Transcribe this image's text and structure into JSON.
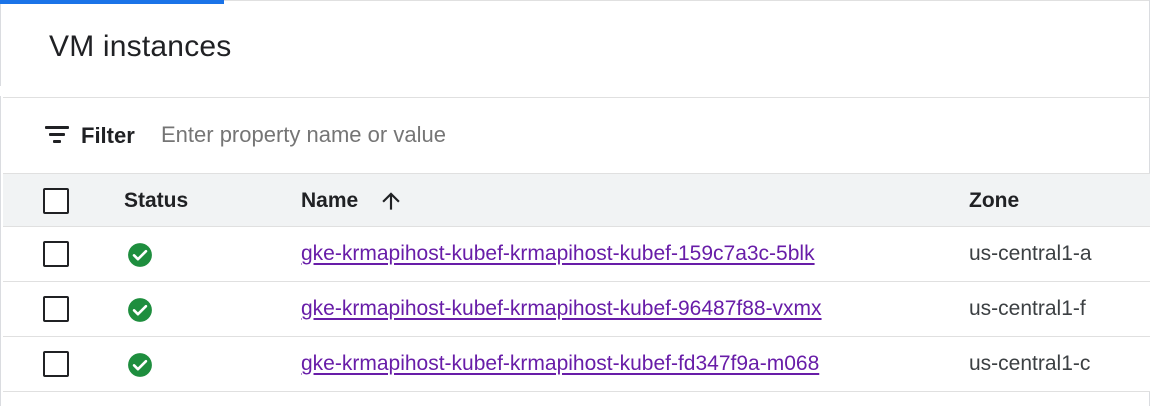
{
  "page": {
    "title": "VM instances"
  },
  "filter": {
    "label": "Filter",
    "placeholder": "Enter property name or value",
    "icon": "filter-list-icon"
  },
  "table": {
    "columns": {
      "select": "",
      "status": "Status",
      "name": "Name",
      "zone": "Zone"
    },
    "sort": {
      "column": "Name",
      "direction": "ascending",
      "icon": "arrow-upward-icon"
    },
    "rows": [
      {
        "selected": false,
        "status": "running",
        "status_icon": "check-circle-icon",
        "name": "gke-krmapihost-kubef-krmapihost-kubef-159c7a3c-5blk",
        "zone": "us-central1-a"
      },
      {
        "selected": false,
        "status": "running",
        "status_icon": "check-circle-icon",
        "name": "gke-krmapihost-kubef-krmapihost-kubef-96487f88-vxmx",
        "zone": "us-central1-f"
      },
      {
        "selected": false,
        "status": "running",
        "status_icon": "check-circle-icon",
        "name": "gke-krmapihost-kubef-krmapihost-kubef-fd347f9a-m068",
        "zone": "us-central1-c"
      }
    ]
  },
  "colors": {
    "accent": "#1a73e8",
    "status_ok": "#1e8e3e",
    "link_visited": "#681da8",
    "header_bg": "#f1f3f4"
  }
}
